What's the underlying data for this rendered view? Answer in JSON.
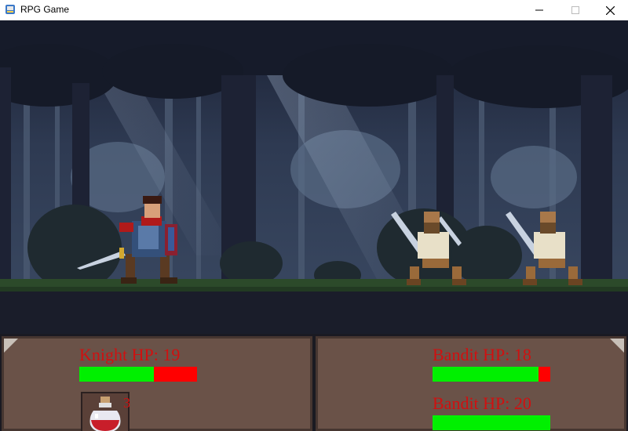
{
  "window": {
    "title": "RPG Game",
    "minimize_label": "—",
    "maximize_label": "☐",
    "close_label": "✕"
  },
  "player": {
    "label": "Knight HP: 19",
    "hp": 19,
    "hp_fraction": 0.63,
    "potion_count": "3",
    "potion_icon": "red-potion-icon"
  },
  "enemies": [
    {
      "label": "Bandit HP: 18",
      "hp": 18,
      "hp_fraction": 0.9
    },
    {
      "label": "Bandit HP: 20",
      "hp": 20,
      "hp_fraction": 1.0
    }
  ],
  "colors": {
    "hp_fill": "#00f000",
    "hp_missing": "#ff0000",
    "label_text": "#d01010",
    "panel_bg": "#6a5248"
  }
}
